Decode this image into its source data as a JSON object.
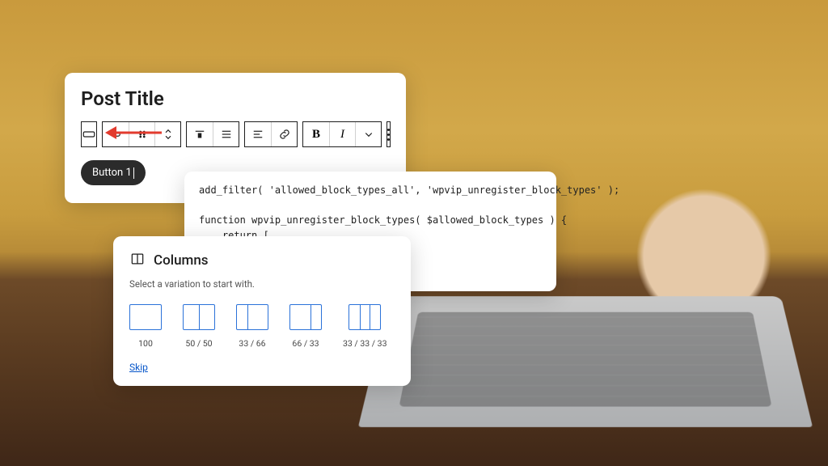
{
  "editor": {
    "title": "Post Title",
    "button_label": "Button 1",
    "toolbar": {
      "block_icon": "button-block-icon",
      "groups": [
        [
          "transform-icon",
          "drag-handle-icon",
          "move-icon"
        ],
        [
          "align-center-icon",
          "justify-icon"
        ],
        [
          "align-text-icon",
          "link-icon"
        ],
        [
          "bold-icon",
          "italic-icon",
          "chevron-down-icon"
        ]
      ],
      "more": "more-options-icon"
    }
  },
  "code": {
    "text": "add_filter( 'allowed_block_types_all', 'wpvip_unregister_block_types' );\n\nfunction wpvip_unregister_block_types( $allowed_block_types ) {\n    return [\n        'core/paragraph',\n        'core/heading',"
  },
  "columns": {
    "title": "Columns",
    "hint": "Select a variation to start with.",
    "variations": [
      {
        "label": "100",
        "dividers": []
      },
      {
        "label": "50 / 50",
        "dividers": [
          50
        ]
      },
      {
        "label": "33 / 66",
        "dividers": [
          33
        ]
      },
      {
        "label": "66 / 33",
        "dividers": [
          66
        ]
      },
      {
        "label": "33 / 33 / 33",
        "dividers": [
          33,
          66
        ]
      }
    ],
    "skip": "Skip"
  }
}
